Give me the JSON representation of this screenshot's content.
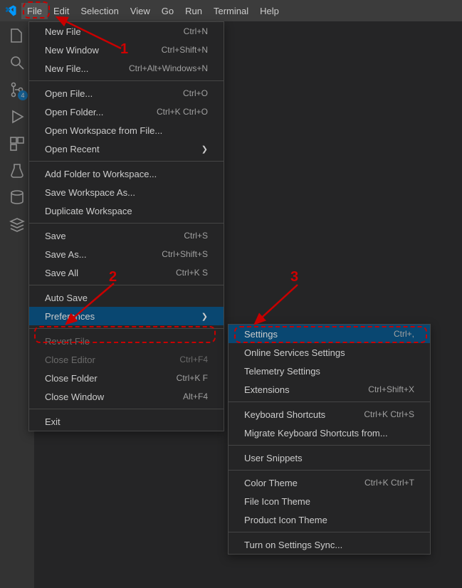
{
  "menubar": {
    "items": [
      "File",
      "Edit",
      "Selection",
      "View",
      "Go",
      "Run",
      "Terminal",
      "Help"
    ],
    "activeIndex": 0
  },
  "activitybar": {
    "icons": [
      "files",
      "search",
      "source-control",
      "run-debug",
      "extensions",
      "test",
      "database",
      "stack"
    ],
    "badgeOn": 2,
    "badgeText": "4"
  },
  "fileMenu": {
    "groups": [
      [
        {
          "label": "New File",
          "shortcut": "Ctrl+N"
        },
        {
          "label": "New Window",
          "shortcut": "Ctrl+Shift+N"
        },
        {
          "label": "New File...",
          "shortcut": "Ctrl+Alt+Windows+N"
        }
      ],
      [
        {
          "label": "Open File...",
          "shortcut": "Ctrl+O"
        },
        {
          "label": "Open Folder...",
          "shortcut": "Ctrl+K Ctrl+O"
        },
        {
          "label": "Open Workspace from File..."
        },
        {
          "label": "Open Recent",
          "submenu": true
        }
      ],
      [
        {
          "label": "Add Folder to Workspace..."
        },
        {
          "label": "Save Workspace As..."
        },
        {
          "label": "Duplicate Workspace"
        }
      ],
      [
        {
          "label": "Save",
          "shortcut": "Ctrl+S"
        },
        {
          "label": "Save As...",
          "shortcut": "Ctrl+Shift+S"
        },
        {
          "label": "Save All",
          "shortcut": "Ctrl+K S"
        }
      ],
      [
        {
          "label": "Auto Save"
        },
        {
          "label": "Preferences",
          "submenu": true,
          "hover": true
        }
      ],
      [
        {
          "label": "Revert File",
          "disabled": true
        },
        {
          "label": "Close Editor",
          "shortcut": "Ctrl+F4",
          "disabled": true
        },
        {
          "label": "Close Folder",
          "shortcut": "Ctrl+K F"
        },
        {
          "label": "Close Window",
          "shortcut": "Alt+F4"
        }
      ],
      [
        {
          "label": "Exit"
        }
      ]
    ]
  },
  "prefsMenu": {
    "groups": [
      [
        {
          "label": "Settings",
          "shortcut": "Ctrl+,",
          "hover": true
        },
        {
          "label": "Online Services Settings"
        },
        {
          "label": "Telemetry Settings"
        },
        {
          "label": "Extensions",
          "shortcut": "Ctrl+Shift+X"
        }
      ],
      [
        {
          "label": "Keyboard Shortcuts",
          "shortcut": "Ctrl+K Ctrl+S"
        },
        {
          "label": "Migrate Keyboard Shortcuts from..."
        }
      ],
      [
        {
          "label": "User Snippets"
        }
      ],
      [
        {
          "label": "Color Theme",
          "shortcut": "Ctrl+K Ctrl+T"
        },
        {
          "label": "File Icon Theme"
        },
        {
          "label": "Product Icon Theme"
        }
      ],
      [
        {
          "label": "Turn on Settings Sync..."
        }
      ]
    ]
  },
  "annotations": {
    "step1": "1",
    "step2": "2",
    "step3": "3"
  }
}
